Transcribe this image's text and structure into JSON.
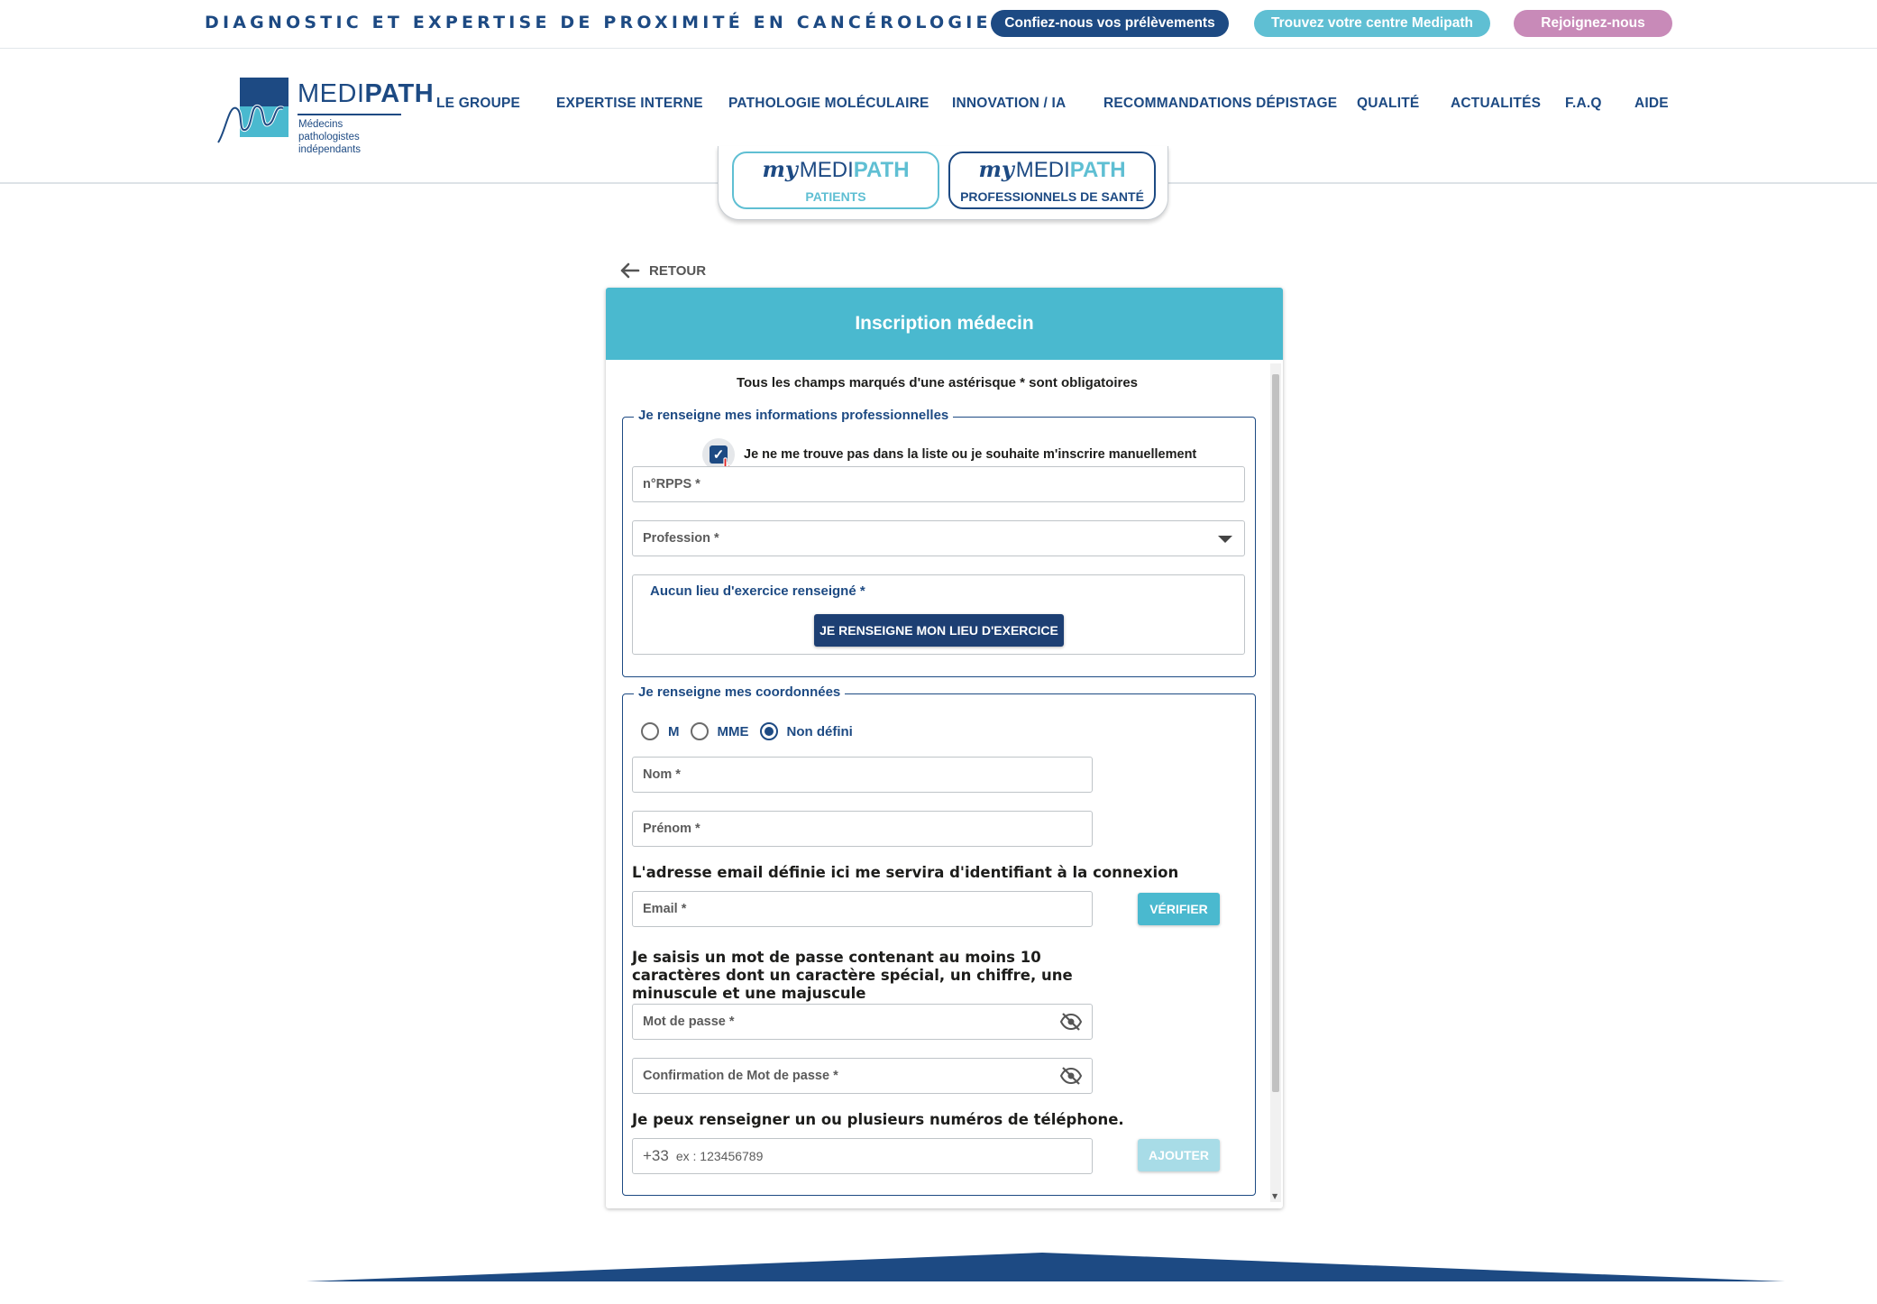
{
  "topbar": {
    "tagline": "DIAGNOSTIC ET EXPERTISE DE PROXIMITÉ EN CANCÉROLOGIE",
    "pills": [
      "Confiez-nous vos prélèvements",
      "Trouvez votre centre Medipath",
      "Rejoignez-nous"
    ]
  },
  "logo": {
    "word_a": "MEDI",
    "word_b": "PATH",
    "sub_1": "Médecins pathologistes",
    "sub_2": "indépendants"
  },
  "nav": [
    "LE GROUPE",
    "EXPERTISE INTERNE",
    "PATHOLOGIE MOLÉCULAIRE",
    "INNOVATION / IA",
    "RECOMMANDATIONS DÉPISTAGE",
    "QUALITÉ",
    "ACTUALITÉS",
    "F.A.Q",
    "AIDE"
  ],
  "mytabs": {
    "brand_my": "my",
    "brand_medi": "MEDI",
    "brand_path": "PATH",
    "patients": "PATIENTS",
    "pros": "PROFESSIONNELS DE SANTÉ"
  },
  "retour": "RETOUR",
  "form": {
    "title": "Inscription médecin",
    "required_note": "Tous les champs marqués d'une astérisque * sont obligatoires",
    "section1": {
      "legend": "Je renseigne mes informations professionnelles",
      "checkbox_label": "Je ne me trouve pas dans la liste ou je souhaite m'inscrire manuellement",
      "checkbox_checked": true,
      "rpps_placeholder": "n°RPPS *",
      "profession_placeholder": "Profession *",
      "lieu_label": "Aucun lieu d'exercice renseigné *",
      "lieu_button": "JE RENSEIGNE MON LIEU D'EXERCICE"
    },
    "section2": {
      "legend": "Je renseigne mes coordonnées",
      "civilite": [
        "M",
        "MME",
        "Non défini"
      ],
      "civilite_selected": "Non défini",
      "nom_placeholder": "Nom *",
      "prenom_placeholder": "Prénom *",
      "email_help": "L'adresse email définie ici me servira d'identifiant à la connexion",
      "email_placeholder": "Email *",
      "verify_button": "VÉRIFIER",
      "password_help": "Je saisis un mot de passe contenant au moins 10 caractères dont un caractère spécial, un chiffre, une minuscule et une majuscule",
      "password_placeholder": "Mot de passe *",
      "password_confirm_placeholder": "Confirmation de Mot de passe *",
      "phone_help": "Je peux renseigner un ou plusieurs numéros de téléphone.",
      "phone_prefix": "+33",
      "phone_placeholder": "ex : 123456789",
      "add_button": "AJOUTER"
    }
  },
  "colors": {
    "navy": "#1d4a83",
    "teal": "#4ab9cf",
    "pink": "#c88ab8"
  }
}
